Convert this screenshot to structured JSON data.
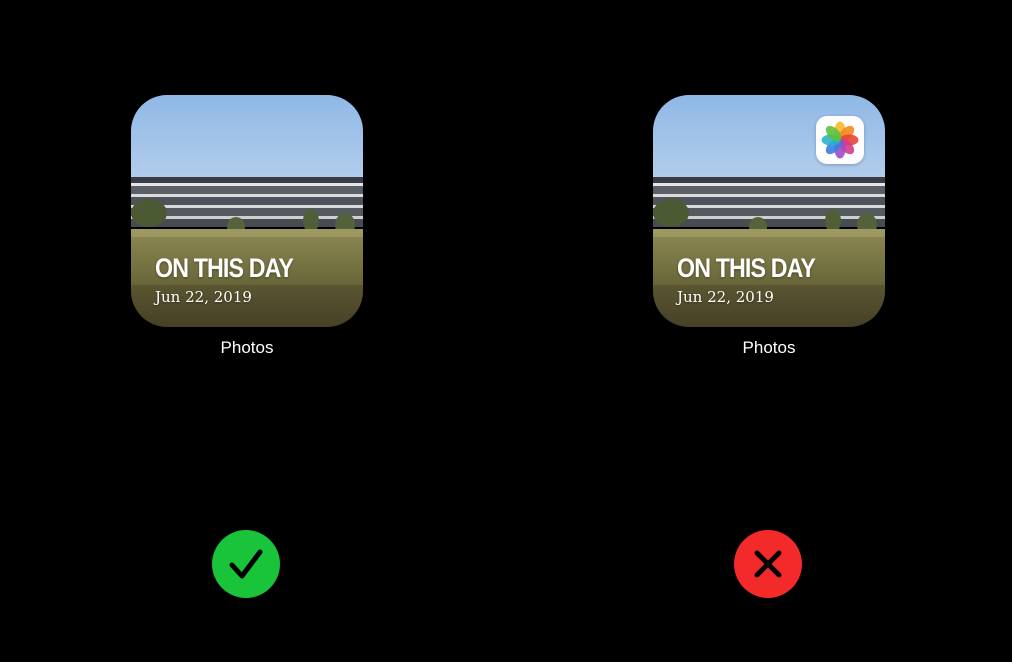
{
  "correct_example": {
    "widget": {
      "headline": "ON THIS DAY",
      "date": "Jun 22, 2019"
    },
    "caption": "Photos",
    "verdict_icon": "checkmark-icon",
    "verdict_color": "#19C33A"
  },
  "incorrect_example": {
    "widget": {
      "headline": "ON THIS DAY",
      "date": "Jun 22, 2019",
      "badge_icon": "photos-app-icon"
    },
    "caption": "Photos",
    "verdict_icon": "x-mark-icon",
    "verdict_color": "#F42A2A"
  },
  "colors": {
    "background": "#000000",
    "text": "#FFFFFF"
  }
}
